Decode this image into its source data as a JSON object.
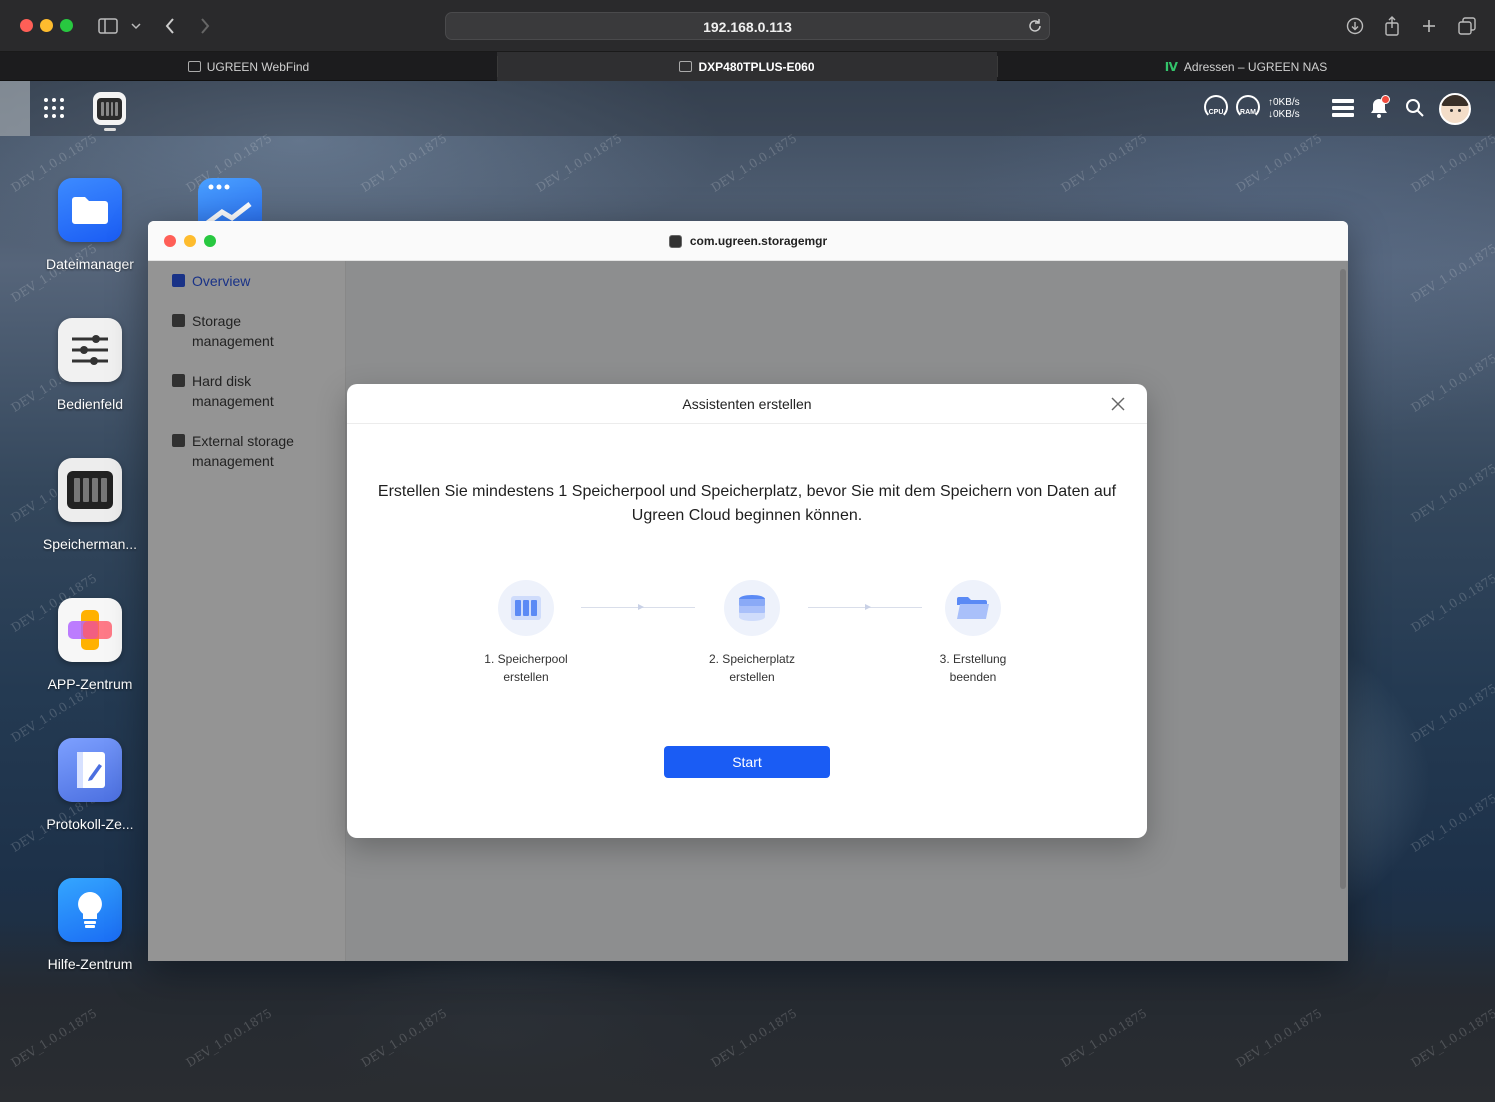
{
  "browser": {
    "url": "192.168.0.113",
    "tabs": [
      {
        "label": "UGREEN WebFind"
      },
      {
        "label": "DXP480TPLUS-E060"
      },
      {
        "label": "Adressen – UGREEN NAS"
      }
    ]
  },
  "topbar": {
    "cpu_label": "CPU",
    "ram_label": "RAM",
    "upload_speed": "↑0KB/s",
    "download_speed": "↓0KB/s"
  },
  "desktop": {
    "icons": [
      {
        "label": "Dateimanager"
      },
      {
        "label": "Bedienfeld"
      },
      {
        "label": "Speicherman..."
      },
      {
        "label": "APP-Zentrum"
      },
      {
        "label": "Protokoll-Ze..."
      },
      {
        "label": "Hilfe-Zentrum"
      }
    ],
    "watermark": "DEV_1.0.0.1875"
  },
  "app_window": {
    "title": "com.ugreen.storagemgr",
    "sidebar": [
      {
        "label": "Overview"
      },
      {
        "label_line1": "Storage",
        "label_line2": "management"
      },
      {
        "label_line1": "Hard disk",
        "label_line2": "management"
      },
      {
        "label_line1": "External storage",
        "label_line2": "management"
      }
    ]
  },
  "modal": {
    "title": "Assistenten erstellen",
    "description": "Erstellen Sie mindestens 1 Speicherpool und Speicherplatz, bevor Sie mit dem Speichern von Daten auf Ugreen Cloud beginnen können.",
    "steps": [
      {
        "line1": "1. Speicherpool",
        "line2": "erstellen"
      },
      {
        "line1": "2. Speicherplatz",
        "line2": "erstellen"
      },
      {
        "line1": "3. Erstellung",
        "line2": "beenden"
      }
    ],
    "start_label": "Start"
  }
}
